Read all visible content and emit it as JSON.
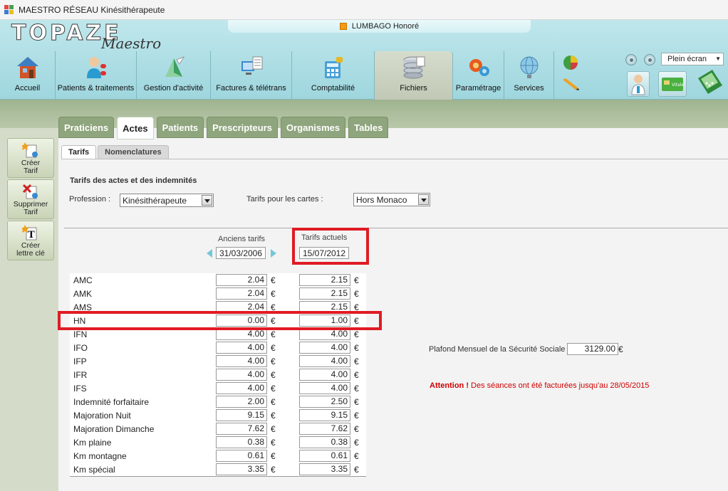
{
  "window": {
    "title": "MAESTRO  RÉSEAU Kinésithérapeute"
  },
  "logo": {
    "main": "TOPAZE",
    "sub": "Maestro"
  },
  "patient": {
    "name": "LUMBAGO Honoré"
  },
  "nav": [
    {
      "label": "Accueil",
      "icon": "house-icon"
    },
    {
      "label": "Patients & traitements",
      "icon": "patient-icon"
    },
    {
      "label": "Gestion d'activité",
      "icon": "activity-icon"
    },
    {
      "label": "Factures & télétrans",
      "icon": "invoice-icon"
    },
    {
      "label": "Comptabilité",
      "icon": "calculator-icon"
    },
    {
      "label": "Fichiers",
      "icon": "database-icon"
    },
    {
      "label": "Paramétrage",
      "icon": "settings-icon"
    },
    {
      "label": "Services",
      "icon": "globe-icon"
    }
  ],
  "screen": {
    "fullscreen_label": "Plein écran"
  },
  "left_actions": [
    {
      "line1": "Créer",
      "line2": "Tarif"
    },
    {
      "line1": "Supprimer",
      "line2": "Tarif"
    },
    {
      "line1": "Créer",
      "line2": "lettre clé"
    }
  ],
  "main_tabs": [
    "Praticiens",
    "Actes",
    "Patients",
    "Prescripteurs",
    "Organismes",
    "Tables"
  ],
  "sub_tabs": [
    "Tarifs",
    "Nomenclatures"
  ],
  "form": {
    "section_title": "Tarifs des actes et des indemnités",
    "profession_label": "Profession :",
    "profession_value": "Kinésithérapeute",
    "cards_label": "Tarifs pour les cartes :",
    "cards_value": "Hors Monaco"
  },
  "columns": {
    "old_label": "Anciens tarifs",
    "old_date": "31/03/2006",
    "new_label": "Tarifs actuels",
    "new_date": "15/07/2012"
  },
  "currency": "€",
  "tarifs": [
    {
      "act": "AMC",
      "old": "2.04",
      "new": "2.15"
    },
    {
      "act": "AMK",
      "old": "2.04",
      "new": "2.15"
    },
    {
      "act": "AMS",
      "old": "2.04",
      "new": "2.15"
    },
    {
      "act": "HN",
      "old": "0.00",
      "new": "1.00"
    },
    {
      "act": "IFN",
      "old": "4.00",
      "new": "4.00"
    },
    {
      "act": "IFO",
      "old": "4.00",
      "new": "4.00"
    },
    {
      "act": "IFP",
      "old": "4.00",
      "new": "4.00"
    },
    {
      "act": "IFR",
      "old": "4.00",
      "new": "4.00"
    },
    {
      "act": "IFS",
      "old": "4.00",
      "new": "4.00"
    },
    {
      "act": "Indemnité forfaitaire",
      "old": "2.00",
      "new": "2.50"
    },
    {
      "act": "Majoration Nuit",
      "old": "9.15",
      "new": "9.15"
    },
    {
      "act": "Majoration Dimanche",
      "old": "7.62",
      "new": "7.62"
    },
    {
      "act": "Km plaine",
      "old": "0.38",
      "new": "0.38"
    },
    {
      "act": "Km montagne",
      "old": "0.61",
      "new": "0.61"
    },
    {
      "act": "Km spécial",
      "old": "3.35",
      "new": "3.35"
    }
  ],
  "plafond": {
    "label": "Plafond Mensuel de la Sécurité Sociale :",
    "value": "3129.00"
  },
  "attention": {
    "strong": "Attention !",
    "text": " Des séances ont été facturées jusqu'au 28/05/2015"
  },
  "colors": {
    "highlight": "#e01b24",
    "tab_green": "#8fa57d",
    "attention_red": "#d00000",
    "patient_swatch": "#f59a12"
  }
}
